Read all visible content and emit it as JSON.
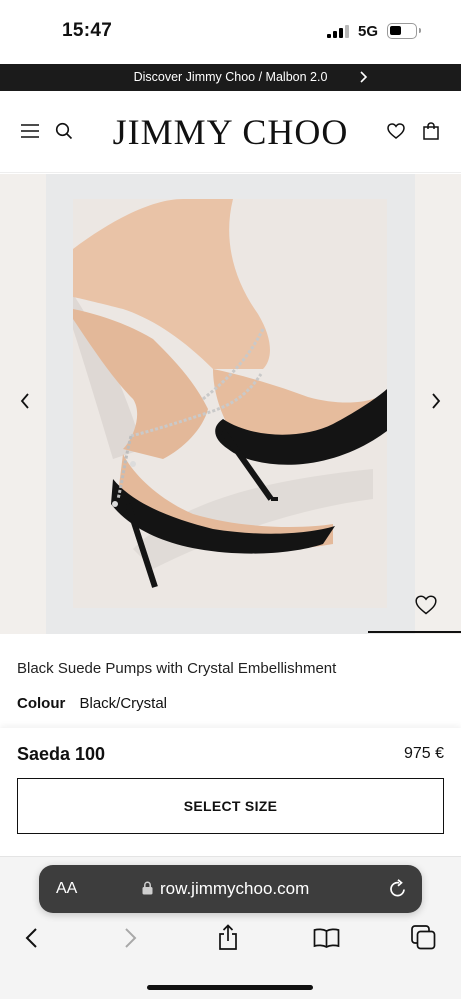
{
  "status_bar": {
    "time": "15:47",
    "network": "5G"
  },
  "promo": {
    "text": "Discover Jimmy Choo / Malbon 2.0",
    "icon": "chevron-right-icon"
  },
  "header": {
    "logo": "JIMMY CHOO",
    "icons": [
      "menu-icon",
      "search-icon",
      "heart-icon",
      "shopping-bag-icon"
    ]
  },
  "gallery": {
    "image_alt": "black suede pumps with crystal ankle chain",
    "icons": [
      "chevron-left-icon",
      "chevron-right-icon",
      "heart-outline-icon"
    ]
  },
  "product": {
    "title": "Black Suede Pumps with Crystal Embellishment",
    "colour_label": "Colour",
    "colour_value": "Black/Crystal",
    "name": "Saeda 100",
    "price": "975 €",
    "cta": "SELECT SIZE"
  },
  "browser": {
    "aa_label": "AA",
    "url": "row.jimmychoo.com",
    "icons": [
      "lock-icon",
      "reload-icon",
      "back-icon",
      "forward-icon",
      "share-icon",
      "bookmarks-icon",
      "tabs-icon"
    ]
  },
  "colors": {
    "banner_bg": "#1b1b1b",
    "gallery_bg": "#f2efec",
    "url_pill_bg": "#3d3d3d"
  }
}
